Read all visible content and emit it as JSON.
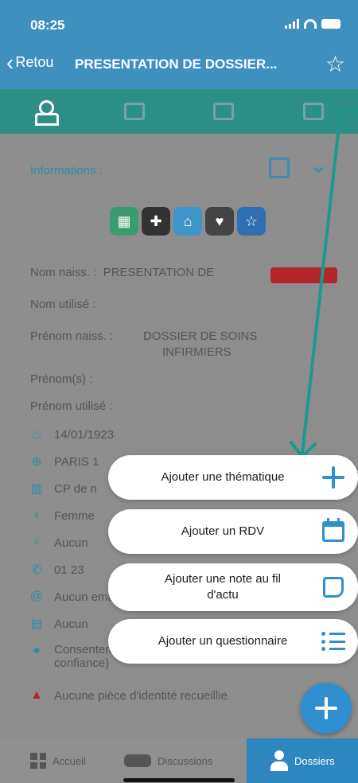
{
  "status": {
    "time": "08:25"
  },
  "nav": {
    "back_label": "Retou",
    "title": "PRESENTATION DE DOSSIER..."
  },
  "info": {
    "section_title": "Informations :",
    "nom_naiss_label": "Nom naiss. :",
    "nom_naiss_value": "PRESENTATION DE",
    "nom_utilise_label": "Nom utilisé :",
    "prenom_naiss_label": "Prénom naiss. :",
    "prenom_naiss_value_1": "DOSSIER DE SOINS",
    "prenom_naiss_value_2": "INFIRMIERS",
    "prenoms_label": "Prénom(s) :",
    "prenom_utilise_label": "Prénom utilisé :",
    "birthdate": "14/01/1923",
    "birthplace": "PARIS 1",
    "postcode": "CP de n",
    "sex": "Femme",
    "row_aucun": "Aucun",
    "phone": "01 23",
    "email": "Aucun email renseigné",
    "consent": "Consentement recueilli (Personne de",
    "consent_2": "confiance)",
    "id_piece": "Aucune pièce d'identité recueillie"
  },
  "menu": {
    "thematique": "Ajouter une thématique",
    "rdv": "Ajouter un RDV",
    "note_1": "Ajouter une note au fil",
    "note_2": "d'actu",
    "questionnaire": "Ajouter un questionnaire"
  },
  "bottom": {
    "accueil": "Accueil",
    "discussions": "Discussions",
    "dossiers": "Dossiers"
  },
  "colors": {
    "accent": "#2f8fd0",
    "teal": "#2e8f84",
    "nav": "#3f8fbf",
    "badge": "#b3262c"
  },
  "icons": [
    "user-icon",
    "star-icon",
    "edit-icon",
    "plus-icon",
    "calendar-icon",
    "note-icon",
    "list-icon"
  ]
}
